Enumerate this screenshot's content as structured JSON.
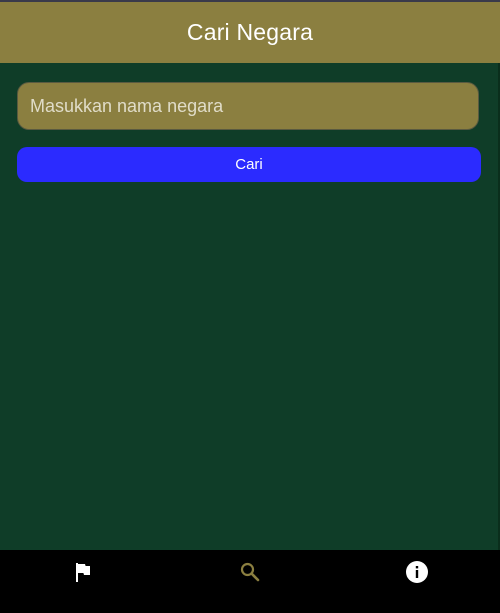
{
  "appbar": {
    "title": "Cari Negara"
  },
  "search": {
    "placeholder": "Masukkan nama negara",
    "value": ""
  },
  "search_button": {
    "label": "Cari"
  },
  "bottom_nav": {
    "items": [
      {
        "icon": "flag-icon",
        "active": false,
        "color": "#ffffff"
      },
      {
        "icon": "search-icon",
        "active": true,
        "color": "#8b7f40"
      },
      {
        "icon": "info-icon",
        "active": false,
        "color": "#ffffff"
      }
    ]
  },
  "colors": {
    "appbar": "#8b7f40",
    "background": "#0f3d28",
    "button": "#2b2bff",
    "nav_background": "#000000"
  }
}
